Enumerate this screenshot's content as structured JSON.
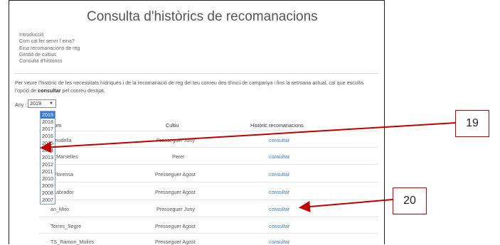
{
  "page": {
    "title": "Consulta d'històrics de recomanacions",
    "nav": [
      "Introducció",
      "Com cal fer servir l´eina?",
      "Eina recomanacions de reg",
      "Gestió de cultius",
      "Consulta d'històrics"
    ],
    "description_pre": "Per veure l'històric de les necessitats hídriques i de la recomanació de reg del teu conreu des d'inici de campanya i fins la setmana actual, cal que escullis l'opció de ",
    "description_bold": "consultar",
    "description_post": " pel conreu desitjat."
  },
  "year_select": {
    "label": "Any :",
    "selected": "2019",
    "caret": "▼",
    "options": [
      "2019",
      "2018",
      "2017",
      "2016",
      "2015",
      "2014",
      "2013",
      "2012",
      "2011",
      "2010",
      "2009",
      "2008",
      "2007"
    ]
  },
  "table": {
    "headers": [
      "Nom",
      "Cultiu",
      "Històric recomanacions"
    ],
    "rows": [
      {
        "name": "ornudella",
        "crop": "Presseguer Juny",
        "action": "consultar"
      },
      {
        "name": "d_Marselles",
        "crop": "Perer",
        "action": "consultar"
      },
      {
        "name": "_Florensa",
        "crop": "Presseguer Agost",
        "action": "consultar"
      },
      {
        "name": "_Labrador",
        "crop": "Presseguer Agost",
        "action": "consultar"
      },
      {
        "name": "an_Miro",
        "crop": "Presseguer Juny",
        "action": "consultar"
      },
      {
        "name": "Torres_Segre",
        "crop": "Presseguer Agost",
        "action": "consultar"
      },
      {
        "name": "TS_Ramon_Molins",
        "crop": "Presseguer Agost",
        "action": "consultar"
      }
    ]
  },
  "callouts": [
    "19",
    "20"
  ],
  "colors": {
    "link": "#3d7fc2",
    "highlight": "#3a78d6",
    "callout": "#c00000"
  }
}
